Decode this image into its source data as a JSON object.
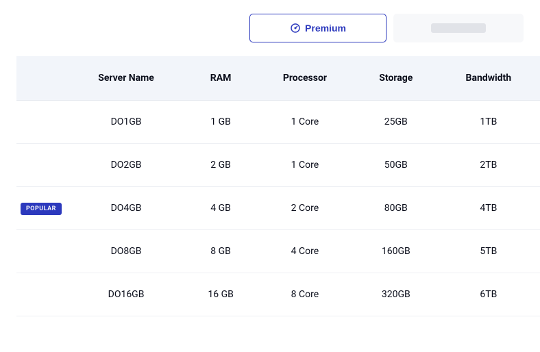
{
  "tabs": {
    "premium_label": "Premium"
  },
  "table": {
    "headers": {
      "server_name": "Server Name",
      "ram": "RAM",
      "processor": "Processor",
      "storage": "Storage",
      "bandwidth": "Bandwidth"
    },
    "rows": [
      {
        "popular": false,
        "server_name": "DO1GB",
        "ram": "1 GB",
        "processor": "1 Core",
        "storage": "25GB",
        "bandwidth": "1TB"
      },
      {
        "popular": false,
        "server_name": "DO2GB",
        "ram": "2 GB",
        "processor": "1 Core",
        "storage": "50GB",
        "bandwidth": "2TB"
      },
      {
        "popular": true,
        "server_name": "DO4GB",
        "ram": "4 GB",
        "processor": "2 Core",
        "storage": "80GB",
        "bandwidth": "4TB"
      },
      {
        "popular": false,
        "server_name": "DO8GB",
        "ram": "8 GB",
        "processor": "4 Core",
        "storage": "160GB",
        "bandwidth": "5TB"
      },
      {
        "popular": false,
        "server_name": "DO16GB",
        "ram": "16 GB",
        "processor": "8 Core",
        "storage": "320GB",
        "bandwidth": "6TB"
      }
    ],
    "popular_label": "POPULAR"
  }
}
